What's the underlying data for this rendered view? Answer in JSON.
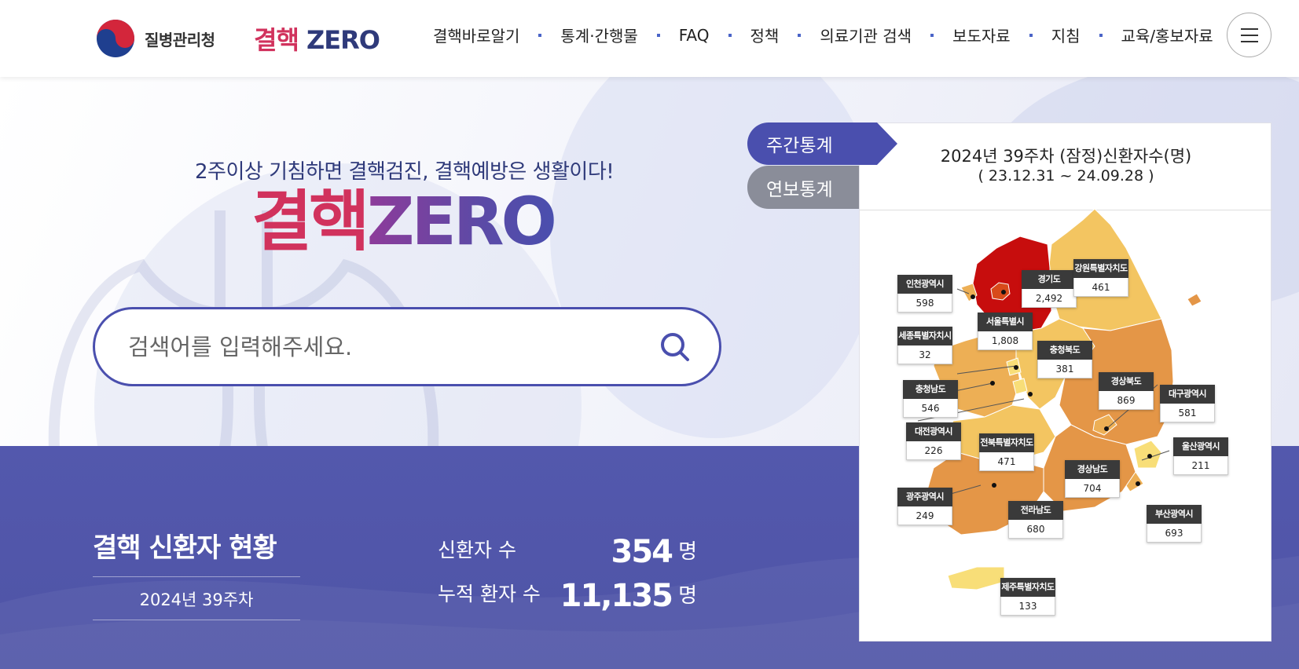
{
  "header": {
    "org_name": "질병관리청",
    "brand_k": "결핵",
    "brand_z": "ZERO",
    "nav": [
      "결핵바로알기",
      "통계·간행물",
      "FAQ",
      "정책",
      "의료기관 검색",
      "보도자료",
      "지침",
      "교육/홍보자료"
    ]
  },
  "hero": {
    "tagline": "2주이상 기침하면 결핵검진, 결핵예방은 생활이다!",
    "title_k": "결핵",
    "title_z": "ZERO",
    "search_placeholder": "검색어를 입력해주세요."
  },
  "stats": {
    "title": "결핵 신환자 현황",
    "week": "2024년 39주차",
    "new_label": "신환자 수",
    "new_value": "354",
    "new_unit": "명",
    "cum_label": "누적 환자 수",
    "cum_value": "11,135",
    "cum_unit": "명"
  },
  "panel": {
    "tab_weekly": "주간통계",
    "tab_annual": "연보통계",
    "title": "2024년 39주차 (잠정)신환자수(명)",
    "range": "( 23.12.31 ~ 24.09.28 )",
    "colors": {
      "high": "#c70d0d",
      "seoul": "#d84a1a",
      "mid_high": "#e49647",
      "mid": "#edaf55",
      "mid_low": "#f3c561",
      "low": "#f8de78"
    },
    "regions": [
      {
        "name": "인천광역시",
        "value": "598"
      },
      {
        "name": "경기도",
        "value": "2,492"
      },
      {
        "name": "강원특별자치도",
        "value": "461"
      },
      {
        "name": "서울특별시",
        "value": "1,808"
      },
      {
        "name": "세종특별자치시",
        "value": "32"
      },
      {
        "name": "충청북도",
        "value": "381"
      },
      {
        "name": "충청남도",
        "value": "546"
      },
      {
        "name": "경상북도",
        "value": "869"
      },
      {
        "name": "대구광역시",
        "value": "581"
      },
      {
        "name": "대전광역시",
        "value": "226"
      },
      {
        "name": "전북특별자치도",
        "value": "471"
      },
      {
        "name": "울산광역시",
        "value": "211"
      },
      {
        "name": "경상남도",
        "value": "704"
      },
      {
        "name": "광주광역시",
        "value": "249"
      },
      {
        "name": "전라남도",
        "value": "680"
      },
      {
        "name": "부산광역시",
        "value": "693"
      },
      {
        "name": "제주특별자치도",
        "value": "133"
      }
    ]
  }
}
